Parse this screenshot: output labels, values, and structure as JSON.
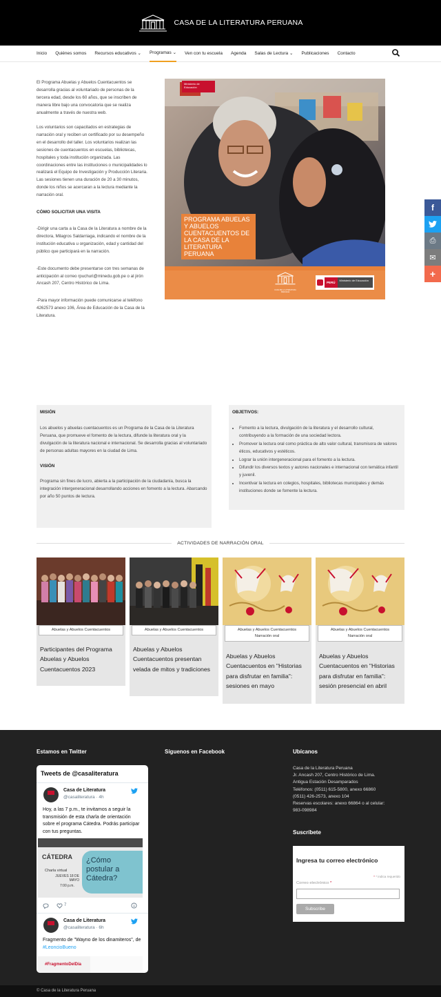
{
  "header": {
    "title": "CASA DE LA LITERATURA PERUANA"
  },
  "nav": {
    "items": [
      {
        "label": "Inicio",
        "has_dropdown": false,
        "active": false
      },
      {
        "label": "Quiénes somos",
        "has_dropdown": false,
        "active": false
      },
      {
        "label": "Recursos educativos",
        "has_dropdown": true,
        "active": false
      },
      {
        "label": "Programas",
        "has_dropdown": true,
        "active": true
      },
      {
        "label": "Ven con tu escuela",
        "has_dropdown": false,
        "active": false
      },
      {
        "label": "Agenda",
        "has_dropdown": false,
        "active": false
      },
      {
        "label": "Salas de Lectura",
        "has_dropdown": true,
        "active": false
      },
      {
        "label": "Publicaciones",
        "has_dropdown": false,
        "active": false
      },
      {
        "label": "Contacto",
        "has_dropdown": false,
        "active": false
      }
    ],
    "search_icon": "search-icon",
    "dropdown_glyph": "⌄"
  },
  "intro": {
    "p1": "El Programa Abuelas y Abuelos Cuentacuentos se desarrolla gracias al voluntariado de personas de la tercera edad, desde los 60 años, que se inscriben de manera libre bajo una convocatoria que se realiza anualmente a través de nuestra web.",
    "p2": "Los voluntarios son capacitados en estrategias de narración oral y reciben un certificado por su desempeño en el desarrollo del taller. Los voluntarios realizan las sesiones de cuentacuentos en escuelas, bibliotecas, hospitales y toda institución organizada. Las coordinaciones entre las instituciones o municipalidades lo realizará el Equipo de Investigación y Producción Literaria. Las sesiones tienen una duración de 20 a 30 minutos, donde los niños se acercaran a la lectura mediante la narración oral.",
    "heading": "CÓMO SOLICITAR UNA VISITA",
    "p3": "-Dirigir una carta a la Casa de la Literatura a nombre de la directora, Milagros Saldarriaga, indicando el nombre de la institución educativa u organización, edad y cantidad del público que participará en la narración.",
    "p4": "-Este documento debe presentarse con tres semanas de anticipación al correo rpuchuri@minedu.gob.pe o al jirón Ancash 207, Centro Histórico de Lima.",
    "p5": "-Para mayor información puede comunicarse al teléfono 4262573 anexo 106, Área de Educación de la Casa de la Literatura."
  },
  "hero": {
    "overlay_text": "PROGRAMA ABUELAS Y ABUELOS CUENTACUENTOS DE LA CASA DE LA LITERATURA PERUANA",
    "top_badge": "Ministerio de Educación",
    "logo_caption": "CASA DE LA LITERATURA PERUANA",
    "ministry_country": "PERÚ",
    "ministry_name": "Ministerio de Educación",
    "orange": "#e8823a"
  },
  "share": [
    {
      "icon": "facebook-icon",
      "color": "#3b5998",
      "glyph": "f"
    },
    {
      "icon": "twitter-icon",
      "color": "#1da1f2",
      "glyph": "🐦"
    },
    {
      "icon": "print-icon",
      "color": "#6c7a86",
      "glyph": "⎙"
    },
    {
      "icon": "email-icon",
      "color": "#7d7d7d",
      "glyph": "✉"
    },
    {
      "icon": "more-icon",
      "color": "#f26a4d",
      "glyph": "+"
    }
  ],
  "mision": {
    "heading": "MISIÓN",
    "text": "Los abuelos y abuelas cuentacuentos es un Programa de la Casa de la Literatura Peruana, que promueve el fomento de la lectura, difunde la literatura oral y la divulgación de la literatura nacional e internacional. Se desarrolla gracias al voluntariado de personas adultas mayores en la ciudad de Lima.",
    "vision_heading": "VISIÓN",
    "vision_text": "Programa sin fines de lucro, abierta a la participación de la ciudadanía, busca la integración intergeneracional desarrollando acciones en fomento a la lectura. Abarcando por año 50 puntos de lectura."
  },
  "objetivos": {
    "heading": "OBJETIVOS:",
    "items": [
      "Fomento a la lectura, divulgación de la literatura y el desarrollo cultural, contribuyendo a la formación de una sociedad lectora.",
      "Promover la lectura oral como práctica de alto valor cultural, transmisora de valores éticos, educativos y estéticos.",
      "Lograr la unión intergeneracional para el fomento a la lectura.",
      "Difundir los diversos textos y autores nacionales e internacional con temática infantil y juvenil.",
      "Incentivar la lectura en colegios, hospitales, bibliotecas municipales y demás instituciones donde se fomente la lectura."
    ]
  },
  "activities": {
    "title": "ACTIVIDADES DE NARRACIÓN ORAL",
    "cards": [
      {
        "tag": "Abuelas y Abuelos Cuentacuentos",
        "tag2": "",
        "title": "Participantes del Programa Abuelas y Abuelos Cuentacuentos 2023"
      },
      {
        "tag": "Abuelas y Abuelos Cuentacuentos",
        "tag2": "",
        "title": "Abuelas y Abuelos Cuentacuentos presentan velada de mitos y tradiciones"
      },
      {
        "tag": "Abuelas y Abuelos Cuentacuentos",
        "tag2": "Narración oral",
        "title": "Abuelas y Abuelos Cuentacuentos en \"Historias para disfrutar en familia\": sesiones en mayo"
      },
      {
        "tag": "Abuelas y Abuelos Cuentacuentos",
        "tag2": "Narración oral",
        "title": "Abuelas y Abuelos Cuentacuentos en \"Historias para disfrutar en familia\": sesión presencial en abril"
      }
    ]
  },
  "footer": {
    "twitter_heading": "Estamos en Twitter",
    "facebook_heading": "Síguenos en Facebook",
    "location_heading": "Ubícanos",
    "address_lines": [
      "Casa de la Literatura Peruana",
      "Jr. Ancash 207, Centro Histórico de Lima.",
      "Antigua Estación Desamparados",
      "Teléfonos: (0511) 615-5800, anexo 66860",
      "(0511) 426-2573, anexo 104",
      "Reservas escolares: anexo 66864 o al celular:",
      "983-098984"
    ],
    "subscribe_heading": "Suscríbete",
    "copyright": "© Casa de la Literatura Peruana"
  },
  "twitter": {
    "title": "Tweets de @casaliteratura",
    "tweet1": {
      "name": "Casa de Literatura",
      "handle": "@casaliteratura · 4h",
      "text": "Hoy, a las 7 p.m., te invitamos a seguir la transmisión de esta charla de orientación sobre el programa Cátedra. Podrás participar con tus preguntas.",
      "img_brand": "CÁTEDRA",
      "img_sub": "Charla virtual",
      "img_date": "JUEVES 18 DE MAYO",
      "img_time": "7:00 p.m.",
      "img_question": "¿Cómo postular a Cátedra?",
      "likes": "7"
    },
    "tweet2": {
      "name": "Casa de Literatura",
      "handle": "@casaliteratura · 6h",
      "text_start": "Fragmento de \"Wayno de los dinamiteros\", de ",
      "link": "#LeoncioBueno",
      "img_tag": "#FragmentoDelDía"
    }
  },
  "subscribe": {
    "title": "Ingresa tu correo electrónico",
    "required_note": "* indica requerido",
    "email_label": "Correo electrónico",
    "button_label": "Subscribe"
  }
}
